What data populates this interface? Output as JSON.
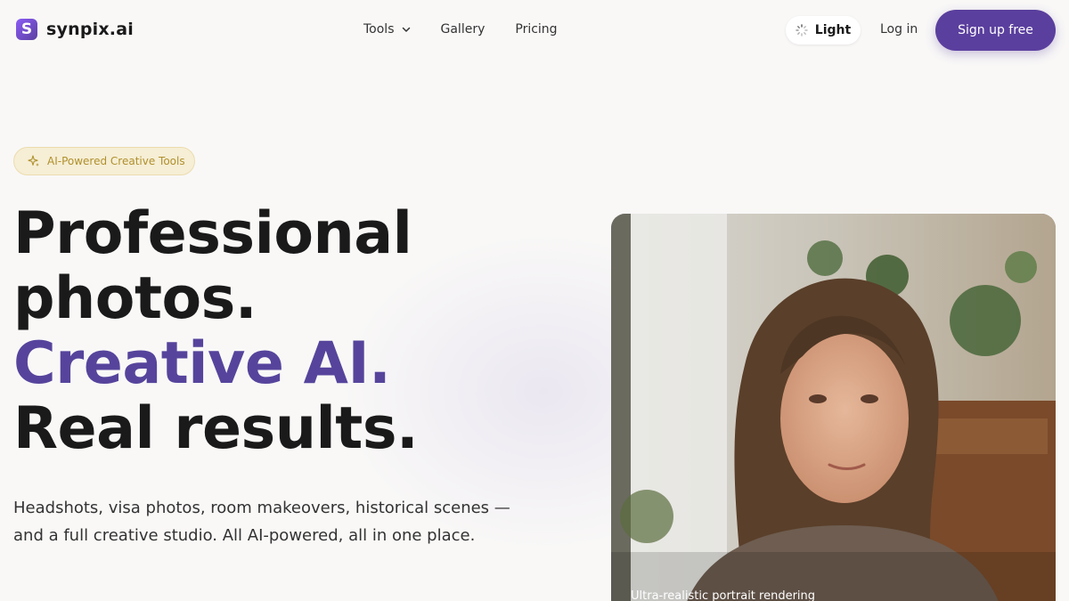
{
  "brand": {
    "logo_letter": "S",
    "name": "synpix.ai",
    "accent": "#5a3f9e"
  },
  "nav": {
    "items": [
      "Tools",
      "Gallery",
      "Pricing"
    ]
  },
  "theme_toggle": {
    "label": "Light",
    "icon": "loader-icon"
  },
  "auth": {
    "login": "Log in",
    "signup": "Sign up free"
  },
  "hero": {
    "badge": "AI-Powered Creative Tools",
    "badge_icon": "sparkle-icon",
    "line1": "Professional",
    "line2": "photos.",
    "line3": "Creative AI.",
    "line4": "Real results.",
    "subtitle": "Headshots, visa photos, room makeovers, historical scenes — and a full creative studio. All AI-powered, all in one place."
  },
  "showcase": {
    "caption": "Ultra-realistic portrait rendering"
  }
}
